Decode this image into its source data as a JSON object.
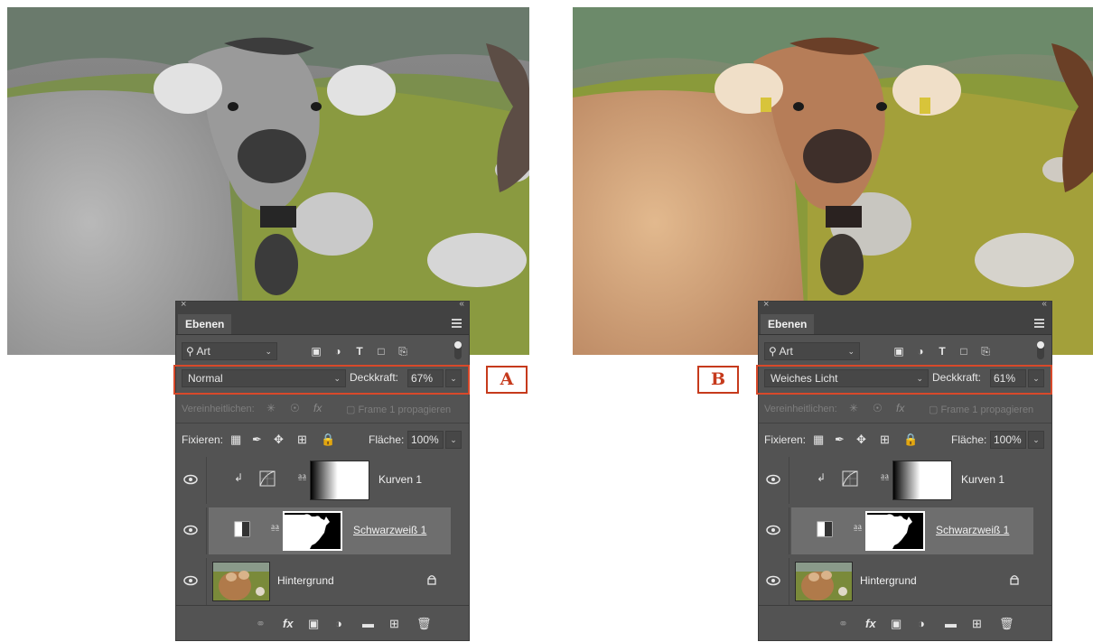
{
  "views": [
    {
      "id": "a",
      "photo_style": "grayscale",
      "callout": "A",
      "panel": {
        "tab": "Ebenen",
        "filter_kind": "Art",
        "blend_mode": "Normal",
        "opacity_label": "Deckkraft:",
        "opacity_value": "67%",
        "unify_label": "Vereinheitlichen:",
        "propagate_label": "Frame 1 propagieren",
        "lock_label": "Fixieren:",
        "fill_label": "Fläche:",
        "fill_value": "100%",
        "layers": [
          {
            "name": "Kurven 1",
            "selected": false
          },
          {
            "name": "Schwarzweiß 1",
            "selected": true
          },
          {
            "name": "Hintergrund",
            "selected": false
          }
        ]
      }
    },
    {
      "id": "b",
      "photo_style": "color",
      "callout": "B",
      "panel": {
        "tab": "Ebenen",
        "filter_kind": "Art",
        "blend_mode": "Weiches Licht",
        "opacity_label": "Deckkraft:",
        "opacity_value": "61%",
        "unify_label": "Vereinheitlichen:",
        "propagate_label": "Frame 1 propagieren",
        "lock_label": "Fixieren:",
        "fill_label": "Fläche:",
        "fill_value": "100%",
        "layers": [
          {
            "name": "Kurven 1",
            "selected": false
          },
          {
            "name": "Schwarzweiß 1",
            "selected": true
          },
          {
            "name": "Hintergrund",
            "selected": false
          }
        ]
      }
    }
  ],
  "colors": {
    "callout_red": "#c63a1c",
    "panel_bg": "#535353",
    "selected_layer": "#6e6e6e"
  }
}
